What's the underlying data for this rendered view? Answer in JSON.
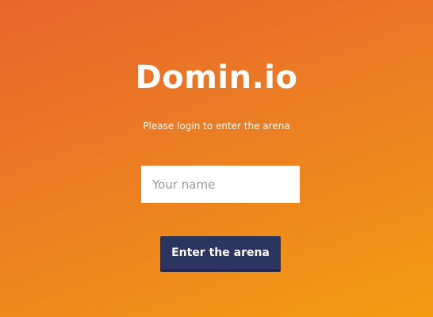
{
  "app": {
    "title": "Domin.io",
    "subtitle": "Please login to enter the arena"
  },
  "login": {
    "name_placeholder": "Your name",
    "name_value": "",
    "submit_label": "Enter the arena"
  },
  "colors": {
    "background_start": "#e8652c",
    "background_end": "#f39c12",
    "button_background": "#2c3560",
    "button_text": "#ffffff",
    "input_background": "#ffffff",
    "placeholder_text": "#9a9a9a"
  }
}
